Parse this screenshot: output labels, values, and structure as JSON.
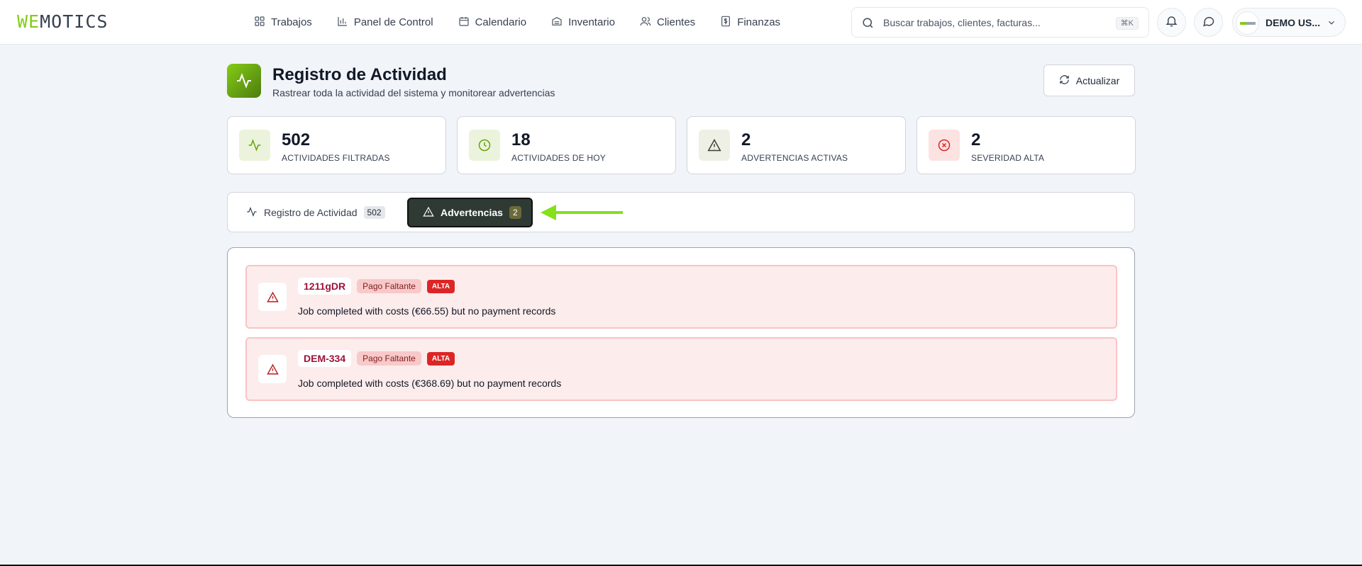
{
  "app": {
    "logo_we": "WE",
    "logo_rest": "MOTICS"
  },
  "nav": {
    "items": [
      {
        "label": "Trabajos",
        "icon": "grid-icon"
      },
      {
        "label": "Panel de Control",
        "icon": "bar-chart-icon"
      },
      {
        "label": "Calendario",
        "icon": "calendar-icon"
      },
      {
        "label": "Inventario",
        "icon": "archive-icon"
      },
      {
        "label": "Clientes",
        "icon": "users-icon"
      },
      {
        "label": "Finanzas",
        "icon": "dollar-file-icon"
      }
    ]
  },
  "search": {
    "placeholder": "Buscar trabajos, clientes, facturas...",
    "shortcut": "⌘K"
  },
  "user": {
    "name": "DEMO US..."
  },
  "header": {
    "title": "Registro de Actividad",
    "subtitle": "Rastrear toda la actividad del sistema y monitorear advertencias",
    "refresh_label": "Actualizar"
  },
  "stats": [
    {
      "value": "502",
      "label": "Actividades filtradas",
      "icon": "activity-icon",
      "color": "#65a30d"
    },
    {
      "value": "18",
      "label": "Actividades de hoy",
      "icon": "clock-icon",
      "color": "#65a30d"
    },
    {
      "value": "2",
      "label": "Advertencias activas",
      "icon": "warning-icon",
      "color": "#3f3f2e"
    },
    {
      "value": "2",
      "label": "Severidad alta",
      "icon": "x-circle-icon",
      "color": "#dc2626"
    }
  ],
  "tabs": [
    {
      "label": "Registro de Actividad",
      "count": "502",
      "active": false
    },
    {
      "label": "Advertencias",
      "count": "2",
      "active": true
    }
  ],
  "warnings": [
    {
      "job_id": "1211gDR",
      "type": "Pago Faltante",
      "severity": "ALTA",
      "message": "Job completed with costs (€66.55) but no payment records"
    },
    {
      "job_id": "DEM-334",
      "type": "Pago Faltante",
      "severity": "ALTA",
      "message": "Job completed with costs (€368.69) but no payment records"
    }
  ],
  "colors": {
    "accent": "#84cc16",
    "active_tab": "#2f3a35",
    "danger": "#dc2626",
    "annotation_arrow": "#84e11a"
  }
}
